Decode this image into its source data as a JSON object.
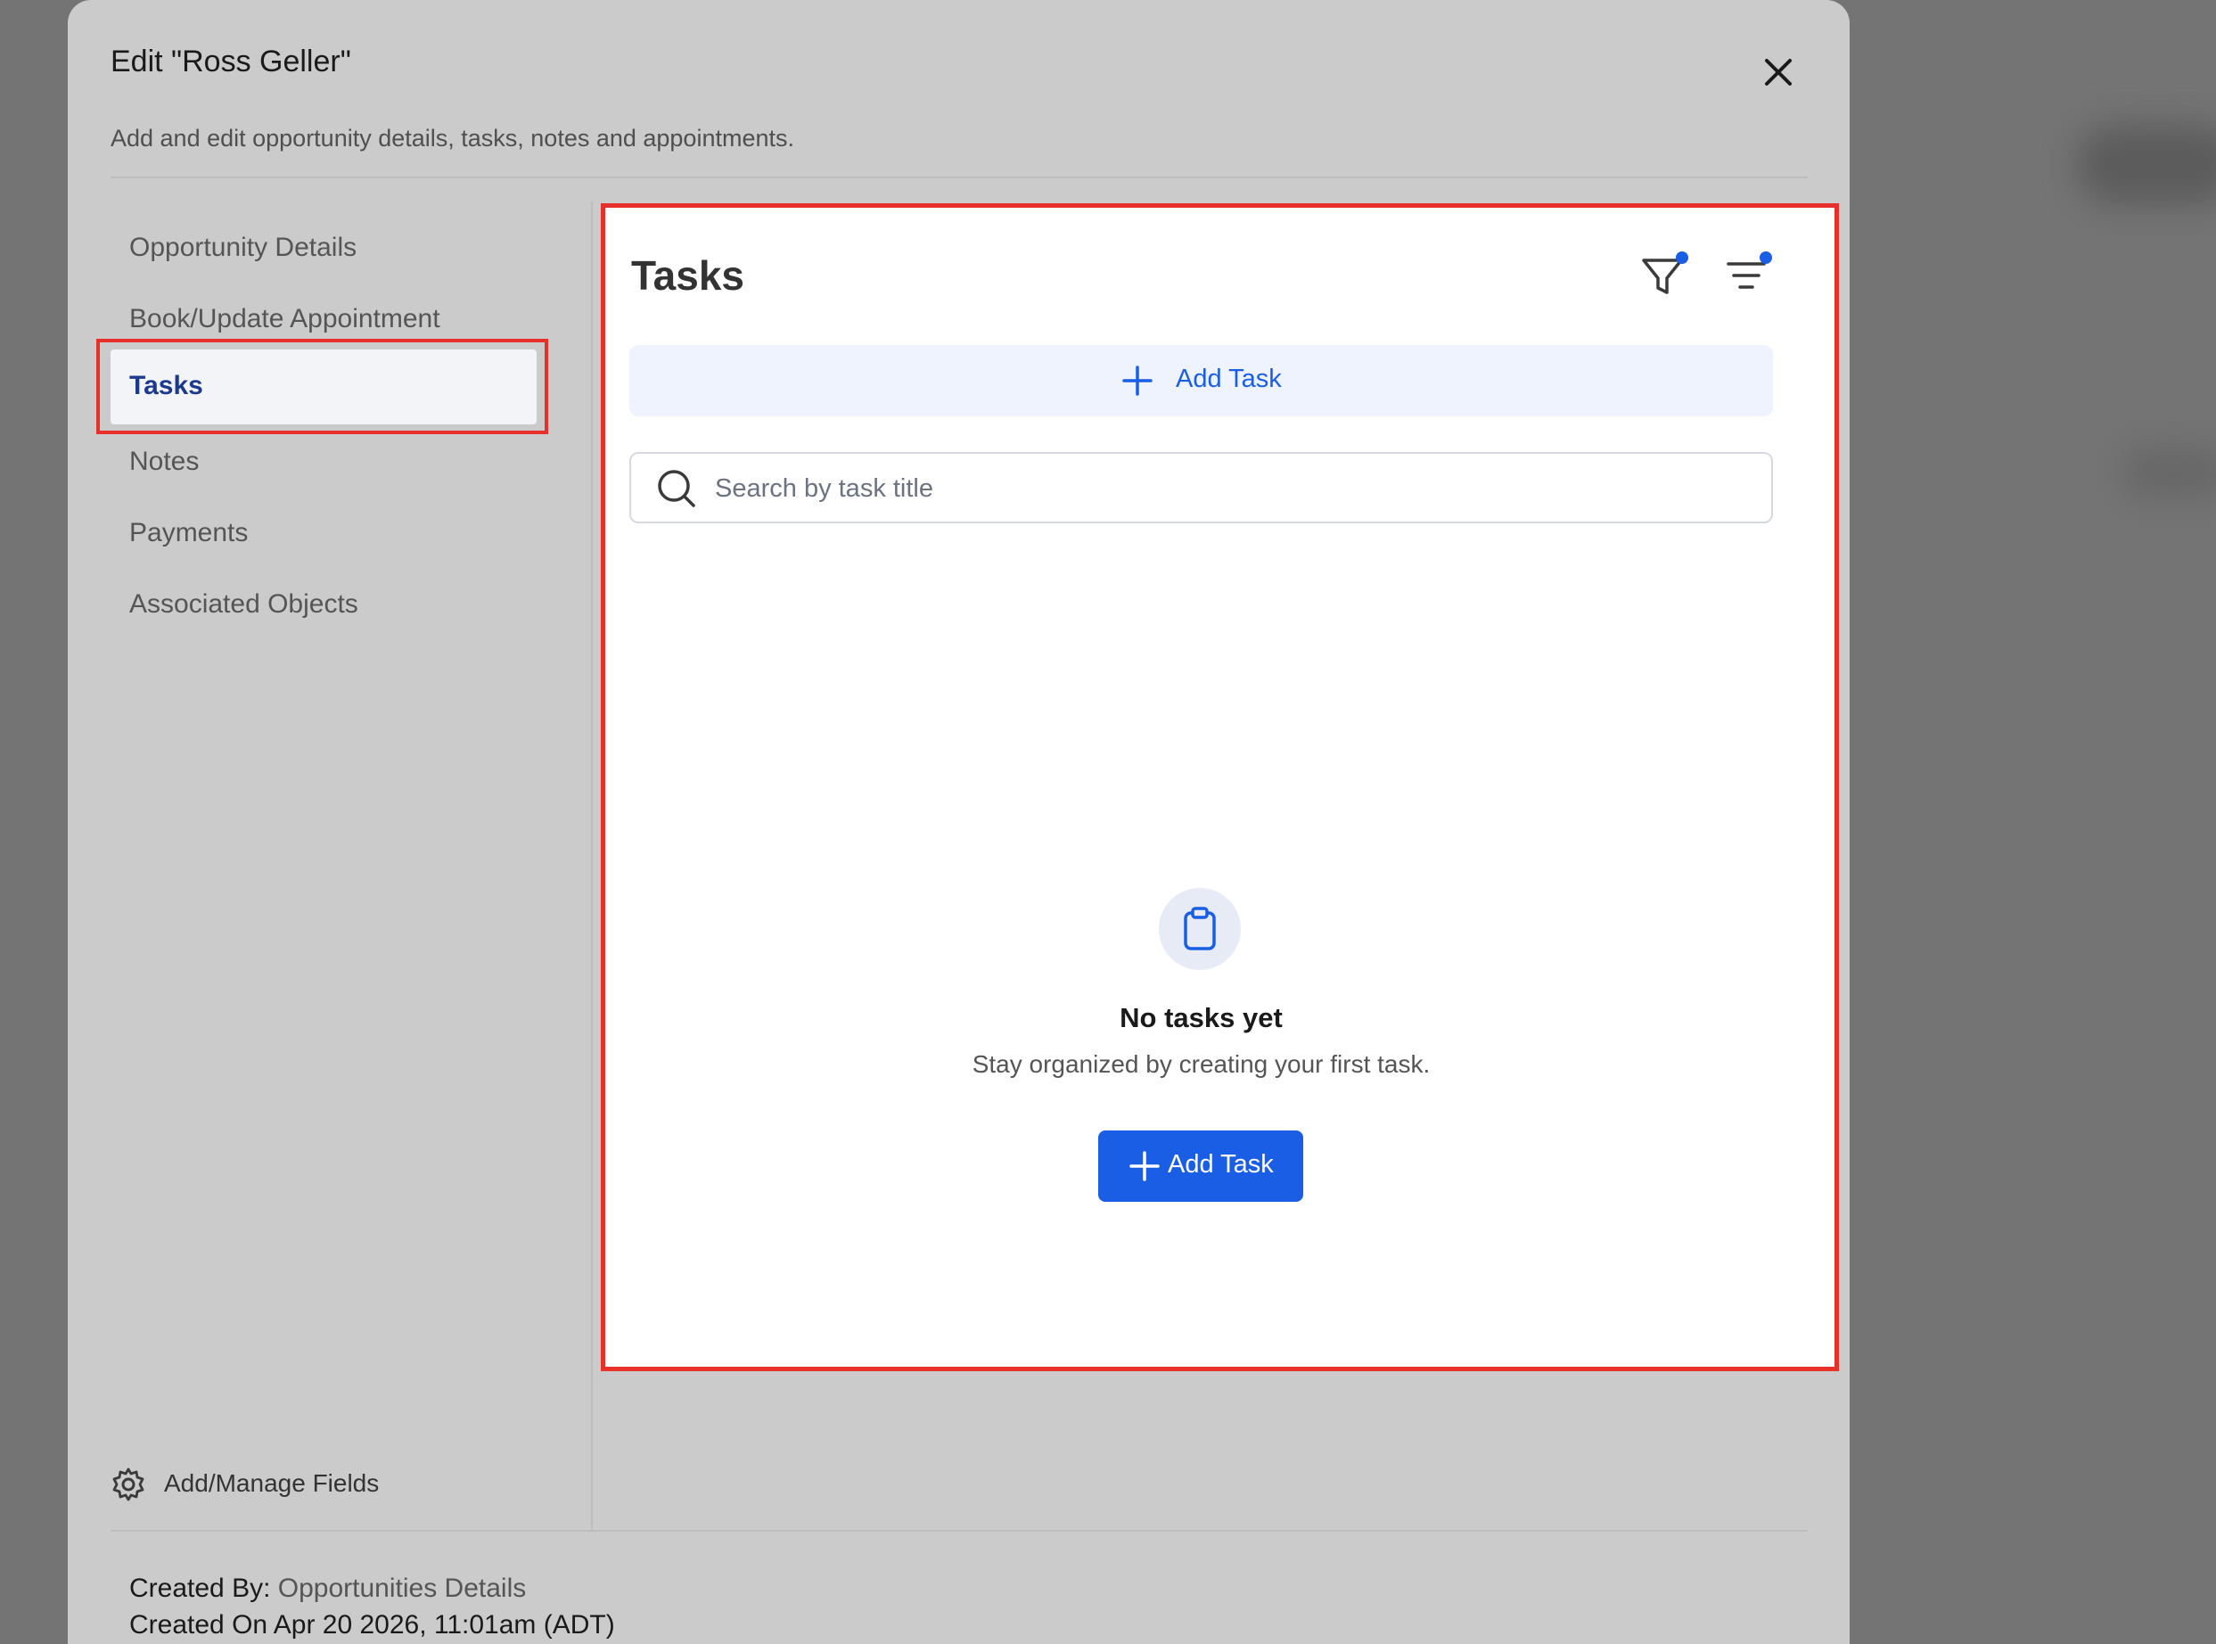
{
  "modal": {
    "title": "Edit \"Ross Geller\"",
    "subtitle": "Add and edit opportunity details, tasks, notes and appointments."
  },
  "sidebar": {
    "items": [
      {
        "label": "Opportunity Details"
      },
      {
        "label": "Book/Update Appointment"
      },
      {
        "label": "Tasks",
        "active": true
      },
      {
        "label": "Notes"
      },
      {
        "label": "Payments"
      },
      {
        "label": "Associated Objects"
      }
    ],
    "manage_fields_label": "Add/Manage Fields"
  },
  "tasks": {
    "title": "Tasks",
    "add_task_label": "Add Task",
    "search_placeholder": "Search by task title",
    "empty_title": "No tasks yet",
    "empty_subtitle": "Stay organized by creating your first task.",
    "empty_button_label": "Add Task",
    "icons": [
      "filter-icon",
      "sort-icon",
      "clipboard-icon",
      "search-icon",
      "plus-icon"
    ]
  },
  "footer": {
    "created_by_label": "Created By:",
    "created_by_value": "Opportunities Details",
    "created_on": "Created On Apr 20 2026, 11:01am (ADT)"
  },
  "colors": {
    "accent": "#1a5ee6",
    "highlight": "#e8302b",
    "active_nav_text": "#1b3a8f"
  }
}
